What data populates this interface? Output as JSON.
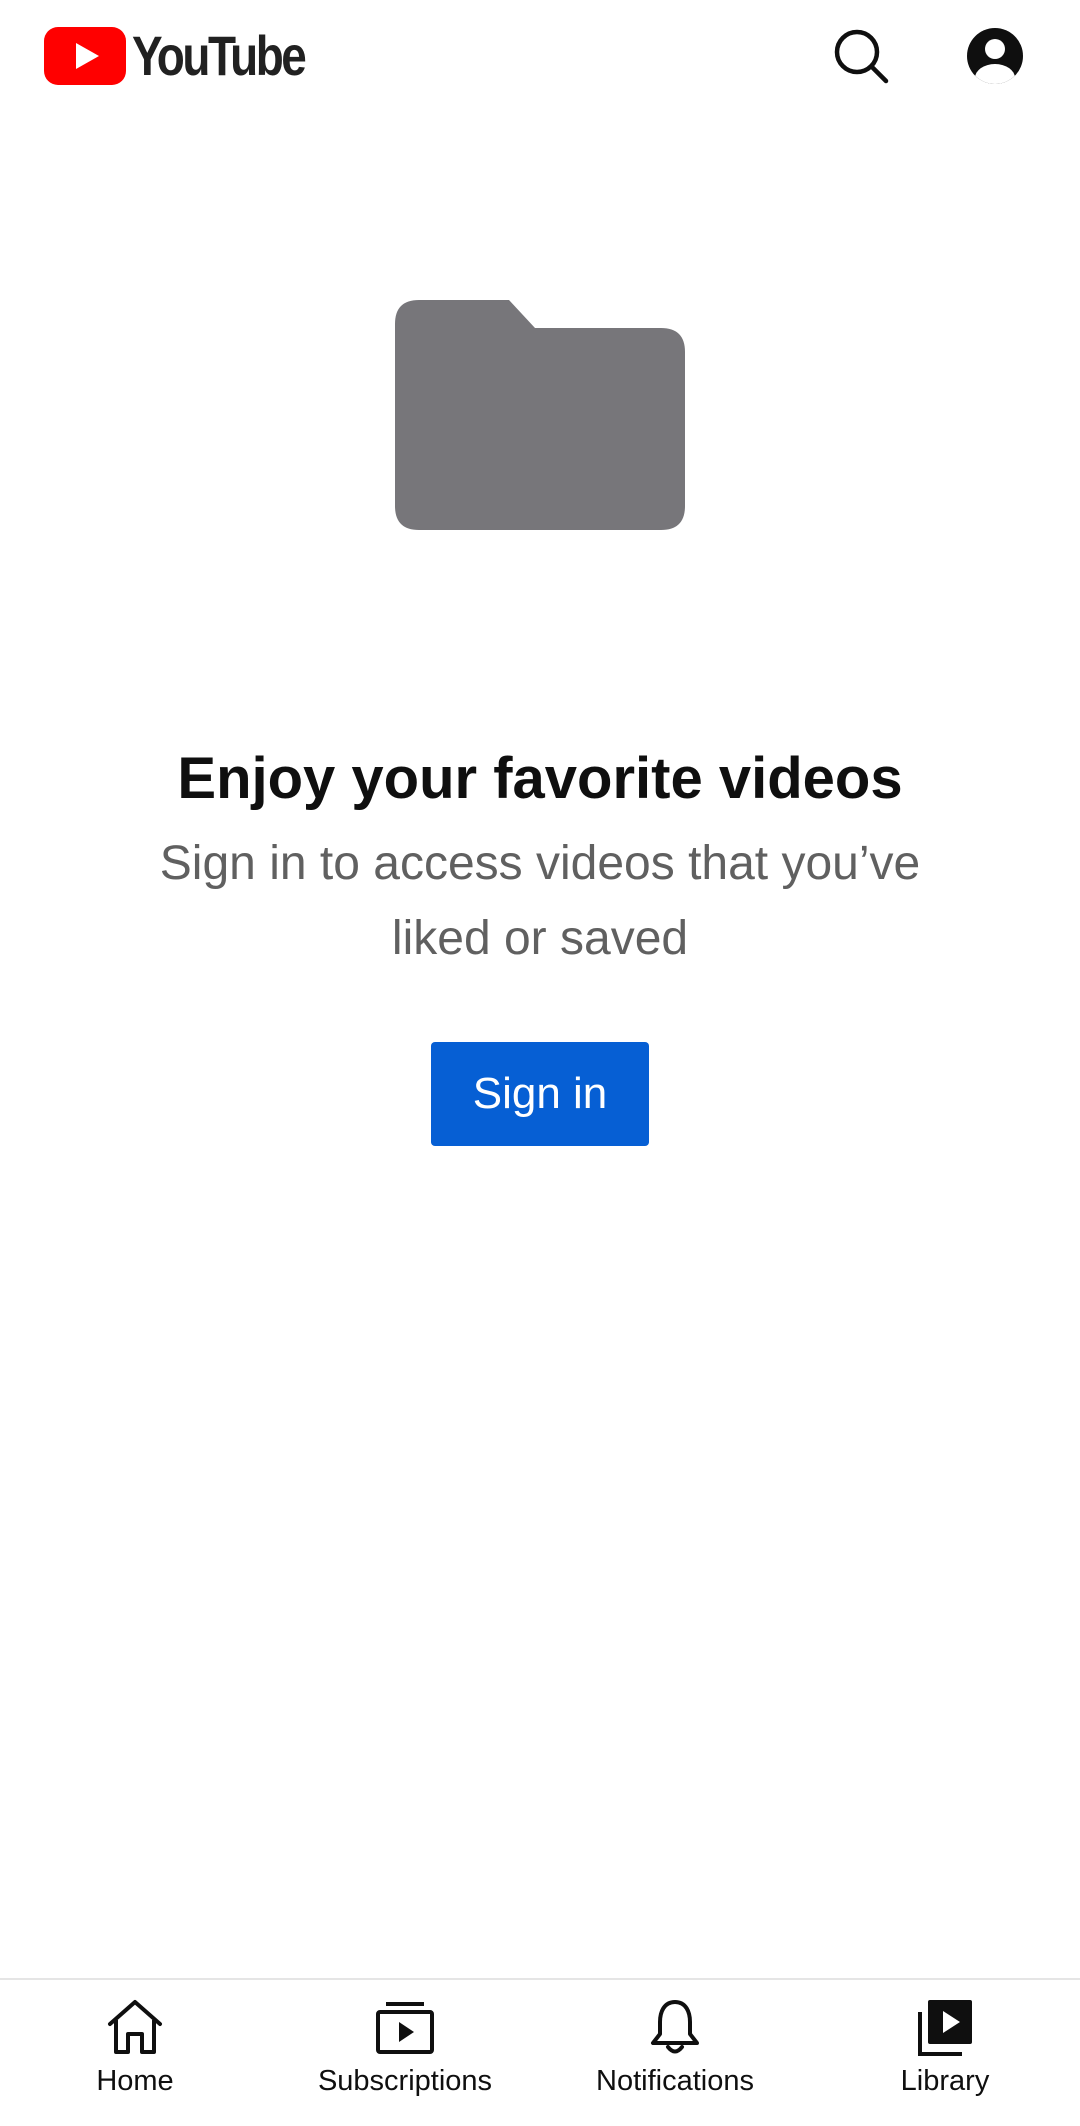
{
  "header": {
    "brand_name": "YouTube",
    "brand_color": "#ff0000",
    "search_icon": "search-icon",
    "account_icon": "account-circle-icon"
  },
  "empty_state": {
    "icon": "folder-icon",
    "title": "Enjoy your favorite videos",
    "subtitle": "Sign in to access videos that you’ve liked or saved",
    "signin_label": "Sign in",
    "button_color": "#065fd4"
  },
  "bottom_nav": {
    "items": [
      {
        "label": "Home",
        "icon": "home-icon"
      },
      {
        "label": "Subscriptions",
        "icon": "subscriptions-icon"
      },
      {
        "label": "Notifications",
        "icon": "bell-icon"
      },
      {
        "label": "Library",
        "icon": "library-icon",
        "selected": true
      }
    ]
  }
}
